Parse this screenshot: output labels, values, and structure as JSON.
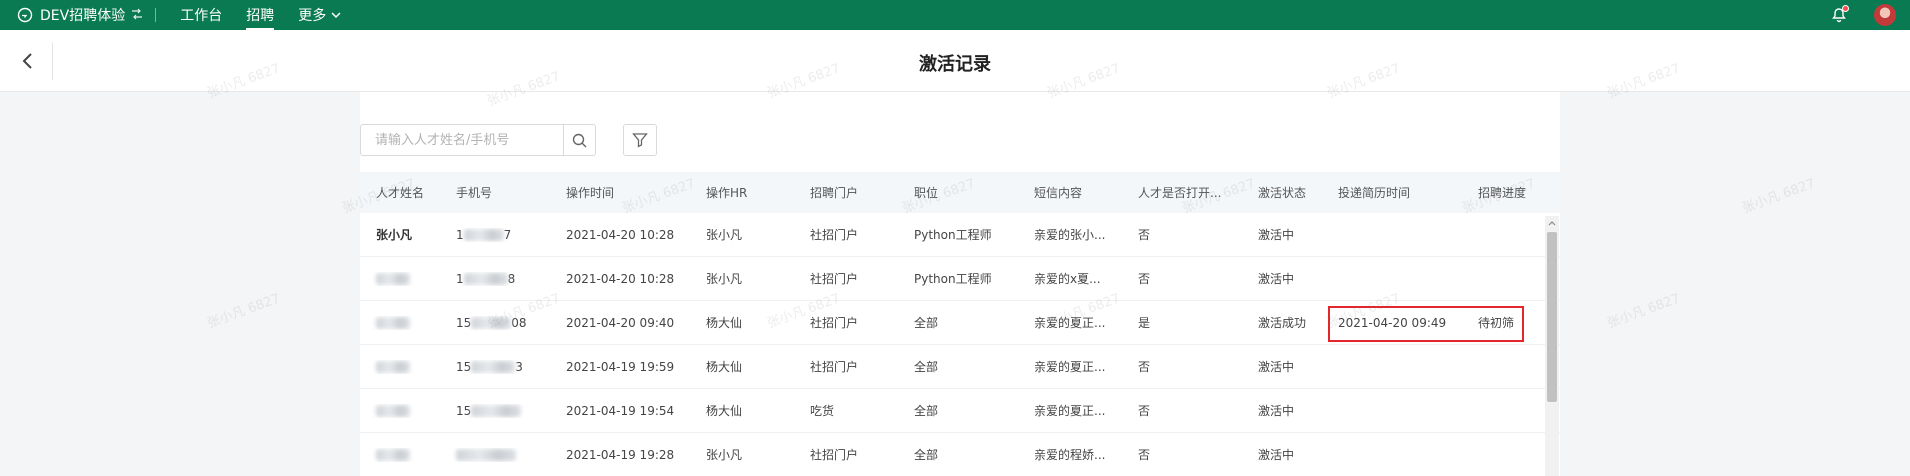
{
  "topbar": {
    "app_title": "DEV招聘体验",
    "nav": [
      {
        "label": "工作台",
        "active": false
      },
      {
        "label": "招聘",
        "active": true
      },
      {
        "label": "更多",
        "active": false
      }
    ],
    "brand_color": "#0a7a52",
    "notification_dot_color": "#ff4d4f"
  },
  "header": {
    "title": "激活记录"
  },
  "search": {
    "placeholder": "请输入人才姓名/手机号"
  },
  "table": {
    "columns": [
      "人才姓名",
      "手机号",
      "操作时间",
      "操作HR",
      "招聘门户",
      "职位",
      "短信内容",
      "人才是否打开...",
      "激活状态",
      "投递简历时间",
      "招聘进度"
    ],
    "rows": [
      {
        "name": "张小凡",
        "phone_prefix": "1",
        "phone_suffix": "7",
        "time": "2021-04-20 10:28",
        "hr": "张小凡",
        "portal": "社招门户",
        "position": "Python工程师",
        "sms": "亲爱的张小...",
        "opened": "否",
        "status": "激活中",
        "apply_time": "",
        "progress": ""
      },
      {
        "name": "",
        "phone_prefix": "1",
        "phone_suffix": "8",
        "time": "2021-04-20 10:28",
        "hr": "张小凡",
        "portal": "社招门户",
        "position": "Python工程师",
        "sms": "亲爱的x夏...",
        "opened": "否",
        "status": "激活中",
        "apply_time": "",
        "progress": ""
      },
      {
        "name": "",
        "phone_prefix": "15",
        "phone_suffix": "08",
        "time": "2021-04-20 09:40",
        "hr": "杨大仙",
        "portal": "社招门户",
        "position": "全部",
        "sms": "亲爱的夏正...",
        "opened": "是",
        "status": "激活成功",
        "apply_time": "2021-04-20 09:49",
        "progress": "待初筛"
      },
      {
        "name": "",
        "phone_prefix": "15",
        "phone_suffix": "3",
        "time": "2021-04-19 19:59",
        "hr": "杨大仙",
        "portal": "社招门户",
        "position": "全部",
        "sms": "亲爱的夏正...",
        "opened": "否",
        "status": "激活中",
        "apply_time": "",
        "progress": ""
      },
      {
        "name": "",
        "phone_prefix": "15",
        "phone_suffix": "",
        "time": "2021-04-19 19:54",
        "hr": "杨大仙",
        "portal": "吃货",
        "position": "全部",
        "sms": "亲爱的夏正...",
        "opened": "否",
        "status": "激活中",
        "apply_time": "",
        "progress": ""
      },
      {
        "name": "",
        "phone_prefix": "",
        "phone_suffix": "",
        "time": "2021-04-19 19:28",
        "hr": "张小凡",
        "portal": "社招门户",
        "position": "全部",
        "sms": "亲爱的程娇...",
        "opened": "否",
        "status": "激活中",
        "apply_time": "",
        "progress": ""
      }
    ]
  },
  "watermark_text": "张小凡 6827",
  "highlight_color": "#e3262b"
}
